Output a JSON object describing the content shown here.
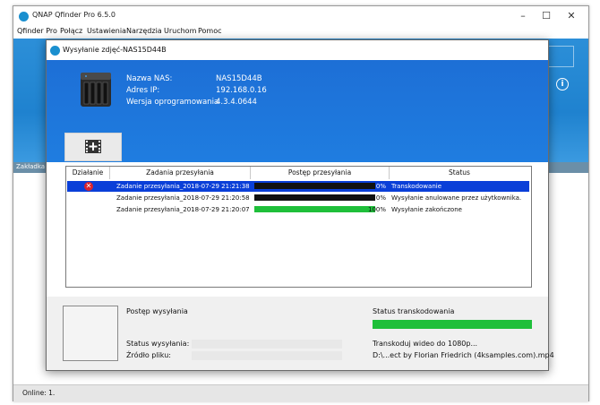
{
  "app": {
    "title": "QNAP Qfinder Pro 6.5.0"
  },
  "menu": [
    "Qfinder Pro",
    "Połącz",
    "Ustawienia",
    "Narzędzia",
    "Uruchom",
    "Pomoc"
  ],
  "tab_label": "Zakładka",
  "status_bar": "Online: 1.",
  "dialog": {
    "title": "Wysyłanie zdjęć-NAS15D44B",
    "nas": {
      "name_label": "Nazwa NAS:",
      "name_value": "NAS15D44B",
      "ip_label": "Adres IP:",
      "ip_value": "192.168.0.16",
      "version_label": "Wersja oprogramowania",
      "version_value": "4.3.4.0644"
    },
    "table": {
      "headers": [
        "Działanie",
        "Zadania przesyłania",
        "Postęp przesyłania",
        "Status"
      ],
      "rows": [
        {
          "task": "Zadanie przesyłania_2018-07-29 21:21:38",
          "progress": 0,
          "progress_label": "0%",
          "status": "Transkodowanie",
          "selected": true,
          "action_icon": "error-x-icon"
        },
        {
          "task": "Zadanie przesyłania_2018-07-29 21:20:58",
          "progress": 0,
          "progress_label": "0%",
          "status": "Wysyłanie anulowane przez użytkownika.",
          "selected": false
        },
        {
          "task": "Zadanie przesyłania_2018-07-29 21:20:07",
          "progress": 100,
          "progress_label": "100%",
          "status": "Wysyłanie zakończone",
          "selected": false
        }
      ]
    },
    "bottom": {
      "upload_progress_title": "Postęp wysyłania",
      "transcode_status_title": "Status transkodowania",
      "upload_status_label": "Status wysyłania:",
      "file_source_label": "Źródło pliku:",
      "transcode_text": "Transkoduj wideo do 1080p...",
      "file_path": "D:\\...ect by Florian Friedrich (4ksamples.com).mp4",
      "transcode_progress": 100
    }
  },
  "colors": {
    "blue_header": "#1f7de0",
    "selected_row": "#0a3fd8",
    "progress_green": "#1fbf3a",
    "error_red": "#d9232d"
  }
}
